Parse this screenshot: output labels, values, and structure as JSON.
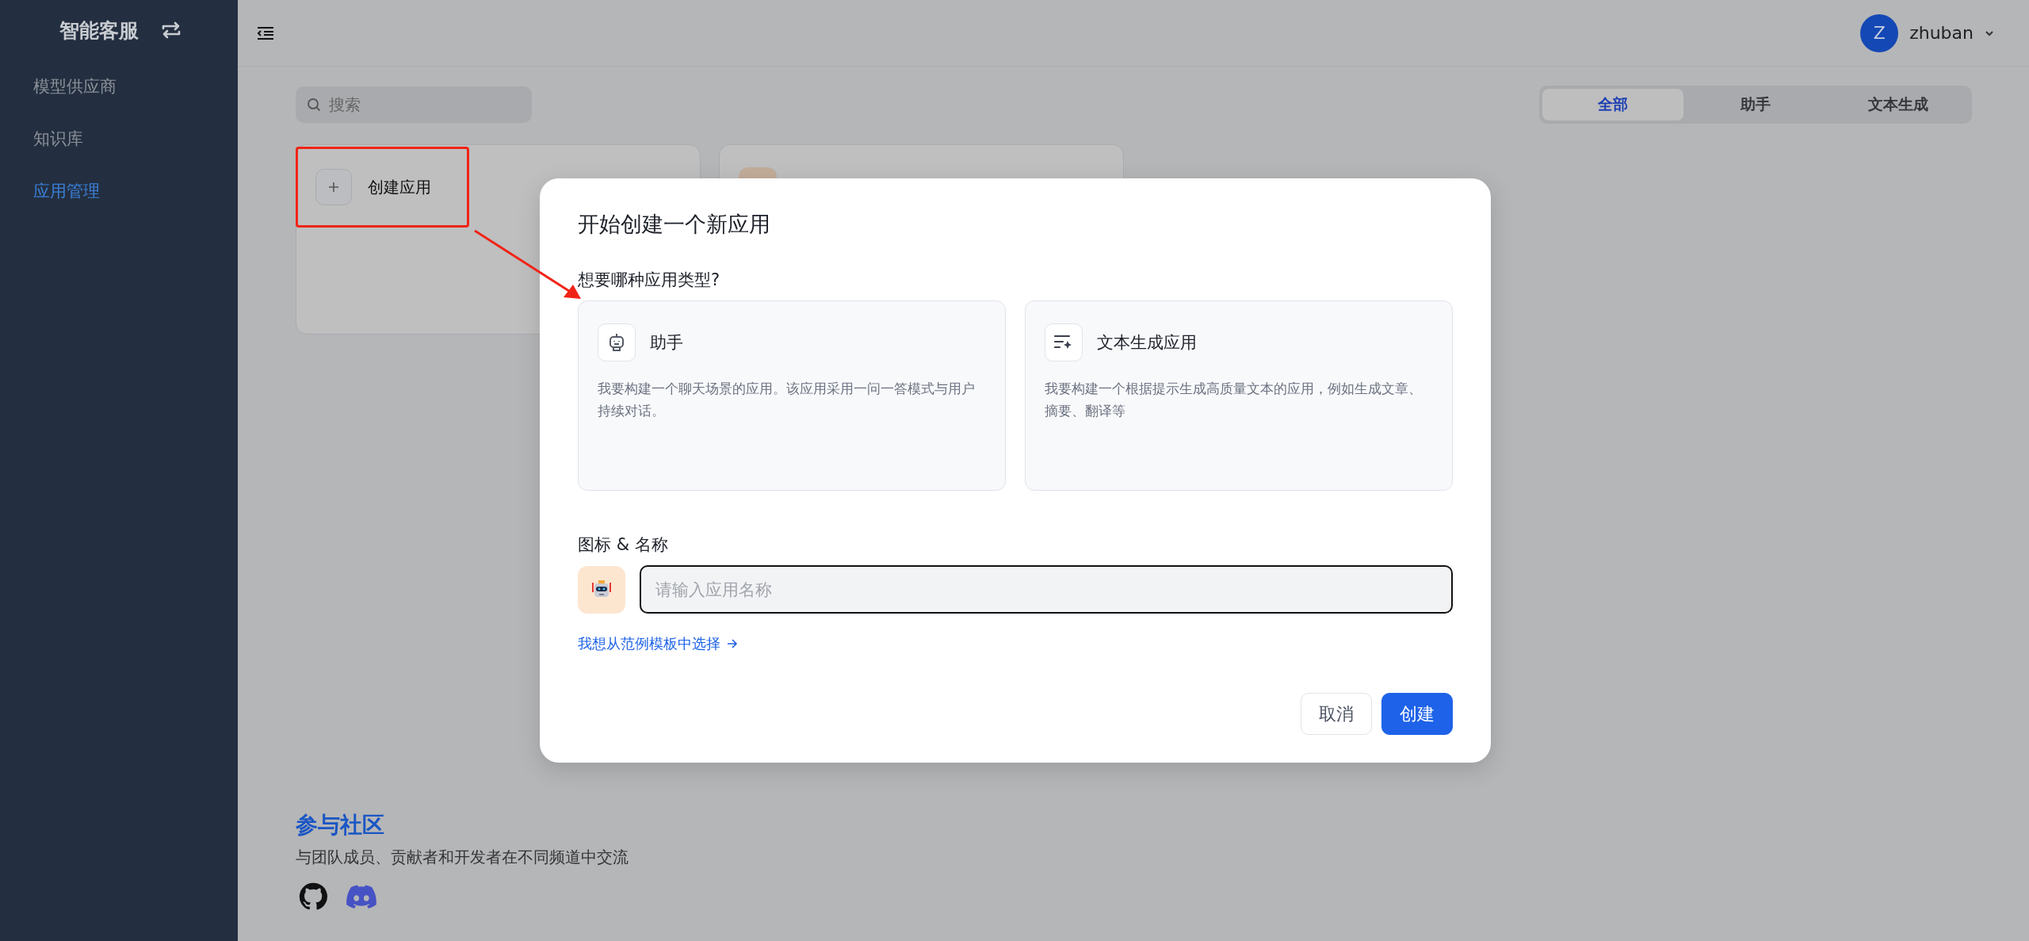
{
  "sidebar": {
    "title": "智能客服",
    "items": [
      {
        "label": "模型供应商",
        "selected": false
      },
      {
        "label": "知识库",
        "selected": false
      },
      {
        "label": "应用管理",
        "selected": true
      }
    ]
  },
  "header": {
    "user": {
      "initial": "Z",
      "name": "zhuban"
    }
  },
  "search": {
    "placeholder": "搜索"
  },
  "filter_tabs": [
    {
      "label": "全部",
      "selected": true
    },
    {
      "label": "助手",
      "selected": false
    },
    {
      "label": "文本生成",
      "selected": false
    }
  ],
  "app_cards": [
    {
      "kind": "create",
      "label": "创建应用",
      "highlighted": true
    },
    {
      "kind": "app",
      "highlighted": false
    }
  ],
  "community": {
    "title": "参与社区",
    "description": "与团队成员、贡献者和开发者在不同频道中交流"
  },
  "dialog": {
    "title": "开始创建一个新应用",
    "question": "想要哪种应用类型?",
    "app_types": [
      {
        "kind": "assistant",
        "title": "助手",
        "description": "我要构建一个聊天场景的应用。该应用采用一问一答模式与用户持续对话。",
        "selected": false
      },
      {
        "kind": "text_generation",
        "title": "文本生成应用",
        "description": "我要构建一个根据提示生成高质量文本的应用，例如生成文章、摘要、翻译等",
        "selected": false
      }
    ],
    "icon_name_label": "图标 & 名称",
    "name_field": {
      "placeholder": "请输入应用名称"
    },
    "template_link": "我想从范例模板中选择",
    "buttons": [
      {
        "kind": "secondary",
        "label": "取消"
      },
      {
        "kind": "primary",
        "label": "创建"
      }
    ]
  }
}
